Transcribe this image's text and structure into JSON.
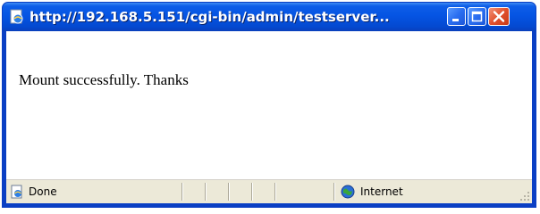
{
  "window": {
    "title": "http://192.168.5.151/cgi-bin/admin/testserver...",
    "controls": {
      "minimize_icon": "minimize-icon",
      "maximize_icon": "maximize-icon",
      "close_icon": "close-icon"
    },
    "app_icon": "ie-page-icon"
  },
  "content": {
    "message": "Mount successfully. Thanks"
  },
  "statusbar": {
    "status_text": "Done",
    "status_icon": "page-done-icon",
    "zone_text": "Internet",
    "zone_icon": "globe-icon"
  },
  "colors": {
    "titlebar": "#0554e3",
    "close_button": "#e1502c",
    "statusbar_bg": "#ece9d8"
  }
}
